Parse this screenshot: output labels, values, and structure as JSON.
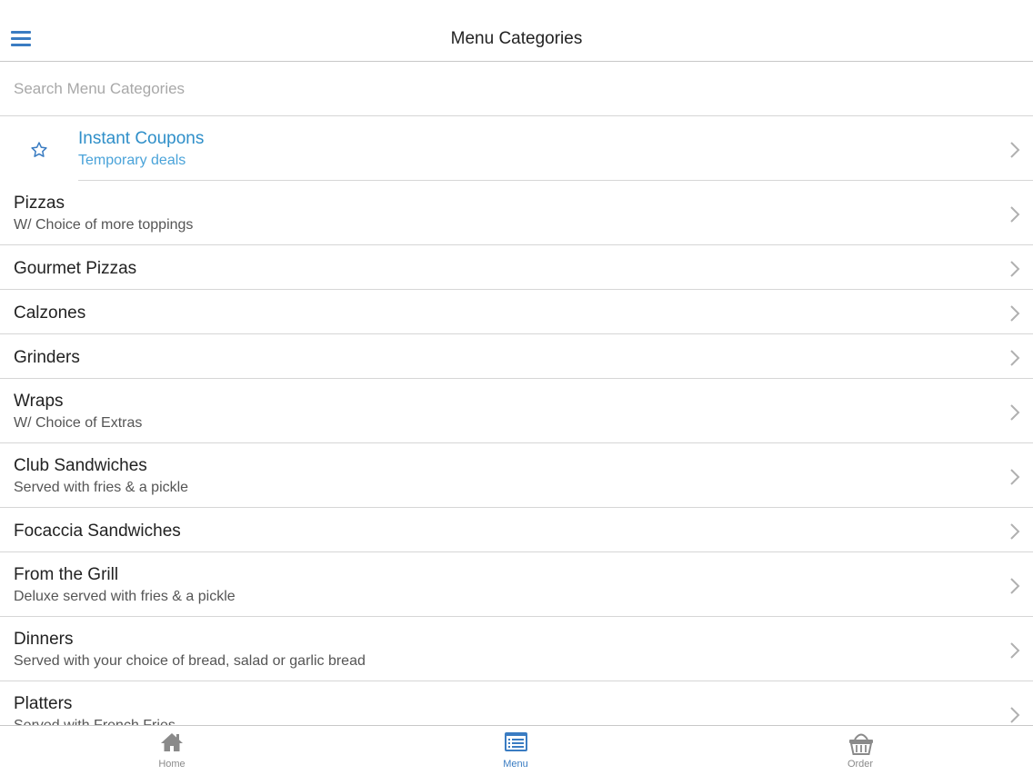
{
  "header": {
    "title": "Menu Categories",
    "menu_icon": "hamburger-menu-icon"
  },
  "search": {
    "placeholder": "Search Menu Categories",
    "value": ""
  },
  "coupon": {
    "name": "Instant Coupons",
    "subtitle": "Temporary deals",
    "icon": "star-icon",
    "color": "#2f8fc9"
  },
  "categories": [
    {
      "name": "Pizzas",
      "subtitle": "W/ Choice of more toppings"
    },
    {
      "name": "Gourmet Pizzas"
    },
    {
      "name": "Calzones"
    },
    {
      "name": "Grinders"
    },
    {
      "name": "Wraps",
      "subtitle": "W/ Choice of Extras"
    },
    {
      "name": "Club Sandwiches",
      "subtitle": "Served with fries & a pickle"
    },
    {
      "name": "Focaccia Sandwiches"
    },
    {
      "name": "From the Grill",
      "subtitle": "Deluxe served with fries & a pickle"
    },
    {
      "name": "Dinners",
      "subtitle": "Served with your choice of bread, salad or garlic bread"
    },
    {
      "name": "Platters",
      "subtitle": "Served with French Fries"
    }
  ],
  "tabs": [
    {
      "label": "Home",
      "icon": "home-icon",
      "active": false
    },
    {
      "label": "Menu",
      "icon": "menu-list-icon",
      "active": true
    },
    {
      "label": "Order",
      "icon": "basket-icon",
      "active": false
    }
  ],
  "colors": {
    "accent": "#3a7cc2",
    "divider": "#d6d6d6",
    "inactive_tab": "#8a8a8a"
  }
}
